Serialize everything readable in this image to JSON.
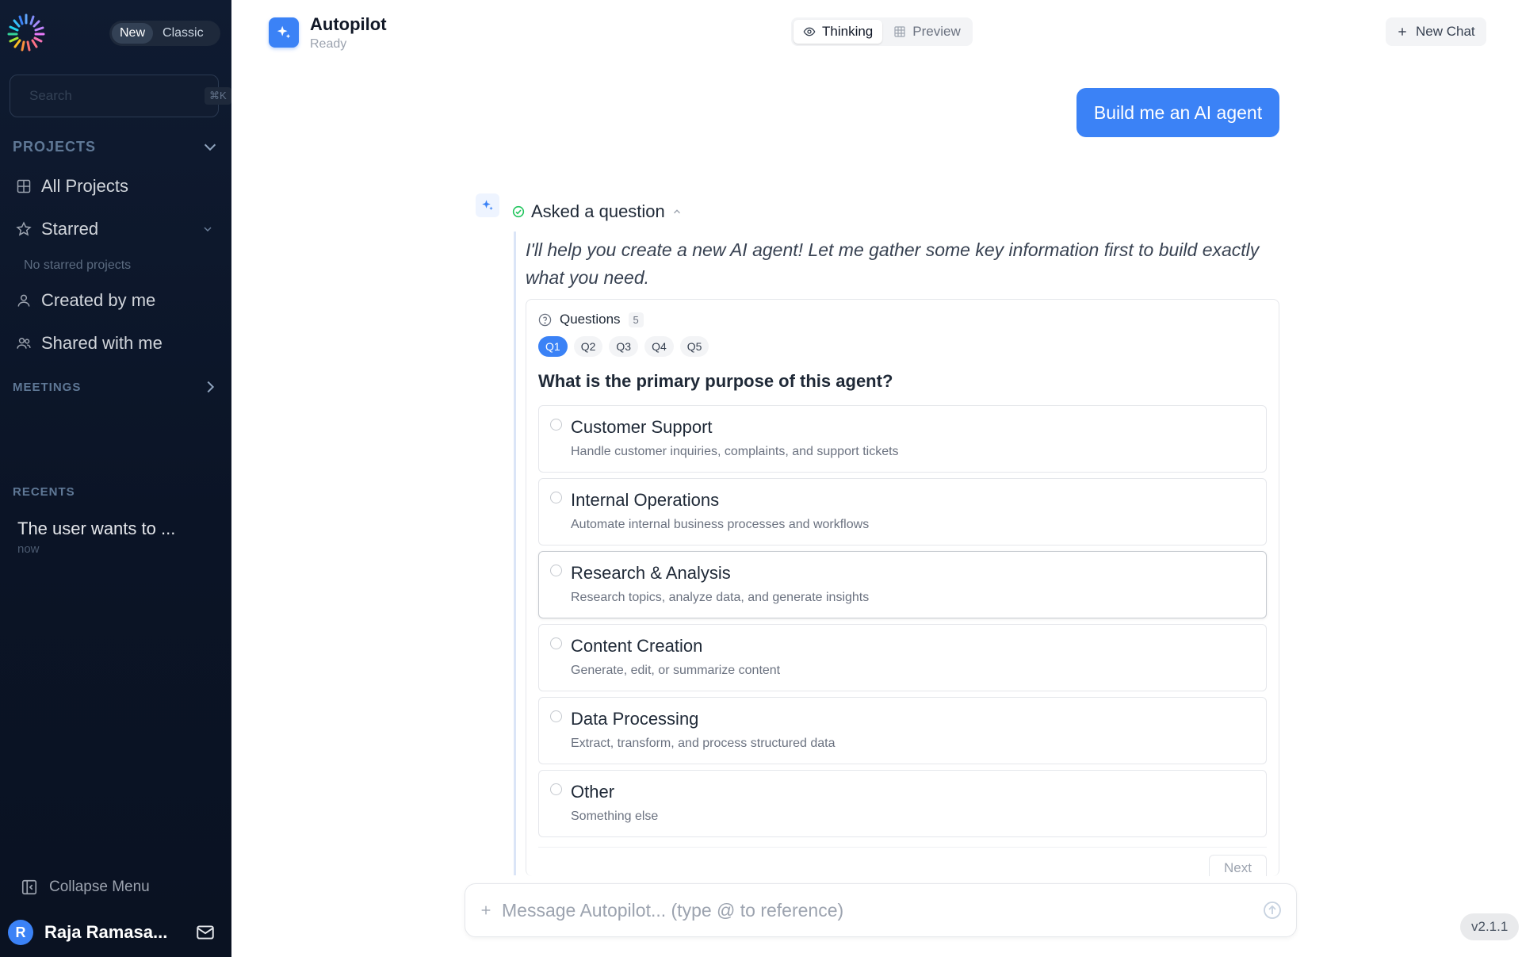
{
  "sidebar": {
    "mode_toggle": {
      "new": "New",
      "classic": "Classic"
    },
    "search": {
      "placeholder": "Search",
      "shortcut": "⌘K"
    },
    "projects_header": "PROJECTS",
    "items": {
      "all_projects": "All Projects",
      "starred": "Starred",
      "no_starred": "No starred projects",
      "created_by_me": "Created by me",
      "shared_with_me": "Shared with me"
    },
    "meetings_header": "MEETINGS",
    "recents_header": "RECENTS",
    "recents": [
      {
        "title": "The user wants to ...",
        "time": "now"
      }
    ],
    "collapse_label": "Collapse Menu",
    "user": {
      "initial": "R",
      "name": "Raja Ramasa..."
    }
  },
  "header": {
    "title": "Autopilot",
    "status": "Ready",
    "views": {
      "thinking": "Thinking",
      "preview": "Preview"
    },
    "new_chat": "New Chat"
  },
  "chat": {
    "user_message": "Build me an AI agent",
    "step_label": "Asked a question",
    "intro": "I'll help you create a new AI agent! Let me gather some key information first to build exactly what you need.",
    "questions": {
      "header": "Questions",
      "count": "5",
      "tabs": [
        "Q1",
        "Q2",
        "Q3",
        "Q4",
        "Q5"
      ],
      "active_tab": "Q1",
      "current_question": "What is the primary purpose of this agent?",
      "options": [
        {
          "label": "Customer Support",
          "desc": "Handle customer inquiries, complaints, and support tickets"
        },
        {
          "label": "Internal Operations",
          "desc": "Automate internal business processes and workflows"
        },
        {
          "label": "Research & Analysis",
          "desc": "Research topics, analyze data, and generate insights"
        },
        {
          "label": "Content Creation",
          "desc": "Generate, edit, or summarize content"
        },
        {
          "label": "Data Processing",
          "desc": "Extract, transform, and process structured data"
        },
        {
          "label": "Other",
          "desc": "Something else"
        }
      ],
      "next_label": "Next"
    }
  },
  "composer": {
    "placeholder": "Message Autopilot... (type @ to reference)"
  },
  "version": "v2.1.1",
  "colors": {
    "accent": "#3b82f6",
    "sidebar_bg": "#0b1426",
    "success": "#22c55e"
  }
}
